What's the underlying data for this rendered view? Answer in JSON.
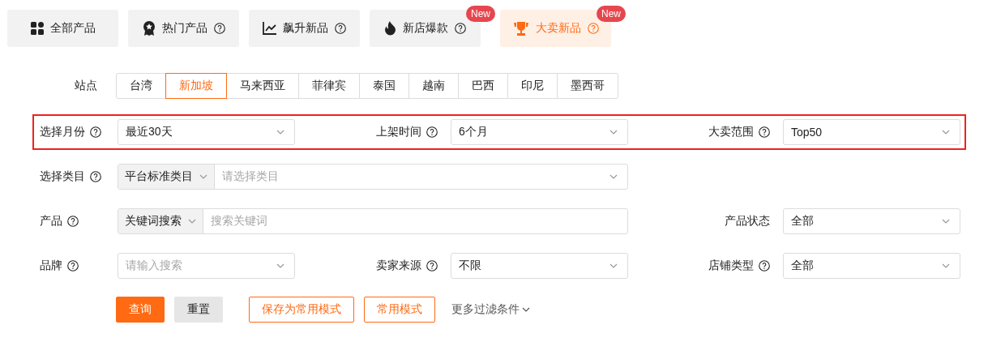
{
  "category_tabs": [
    {
      "label": "全部产品",
      "kind": "grid",
      "help": false,
      "selected": false
    },
    {
      "label": "热门产品",
      "kind": "medal",
      "help": true,
      "selected": false
    },
    {
      "label": "飙升新品",
      "kind": "chart",
      "help": true,
      "selected": false
    },
    {
      "label": "新店爆款",
      "kind": "flame",
      "help": true,
      "selected": false,
      "badge": "New"
    },
    {
      "label": "大卖新品",
      "kind": "trophy",
      "help": true,
      "selected": true,
      "badge": "New"
    }
  ],
  "site": {
    "label": "站点",
    "options": [
      {
        "label": "台湾",
        "selected": false
      },
      {
        "label": "新加坡",
        "selected": true
      },
      {
        "label": "马来西亚",
        "selected": false
      },
      {
        "label": "菲律宾",
        "selected": false
      },
      {
        "label": "泰国",
        "selected": false
      },
      {
        "label": "越南",
        "selected": false
      },
      {
        "label": "巴西",
        "selected": false
      },
      {
        "label": "印尼",
        "selected": false
      },
      {
        "label": "墨西哥",
        "selected": false
      }
    ]
  },
  "filter_rows": [
    {
      "highlighted": true,
      "fields": [
        {
          "kind": "select",
          "label": "选择月份",
          "help": true,
          "value": "最近30天"
        },
        {
          "kind": "select",
          "label": "上架时间",
          "help": true,
          "value": "6个月"
        },
        {
          "kind": "select",
          "label": "大卖范围",
          "help": true,
          "value": "Top50"
        }
      ]
    },
    {
      "highlighted": false,
      "fields": [
        {
          "kind": "combo",
          "label": "选择类目",
          "help": true,
          "prefix": "平台标准类目",
          "placeholder": "请选择类目",
          "dropdown": true
        }
      ]
    },
    {
      "highlighted": false,
      "fields": [
        {
          "kind": "combo",
          "label": "产品",
          "help": true,
          "prefix": "关键词搜索",
          "placeholder": "搜索关键词",
          "dropdown": false
        },
        {
          "kind": "select",
          "label": "产品状态",
          "help": false,
          "value": "全部"
        }
      ]
    },
    {
      "highlighted": false,
      "fields": [
        {
          "kind": "select",
          "label": "品牌",
          "help": true,
          "placeholder": "请输入搜索"
        },
        {
          "kind": "select",
          "label": "卖家来源",
          "help": true,
          "value": "不限"
        },
        {
          "kind": "select",
          "label": "店铺类型",
          "help": true,
          "value": "全部"
        }
      ]
    }
  ],
  "actions": [
    {
      "kind": "primary",
      "label": "查询"
    },
    {
      "kind": "secondary",
      "label": "重置"
    },
    {
      "kind": "outline",
      "label": "保存为常用模式"
    },
    {
      "kind": "outline",
      "label": "常用模式"
    },
    {
      "kind": "link",
      "label": "更多过滤条件"
    }
  ]
}
